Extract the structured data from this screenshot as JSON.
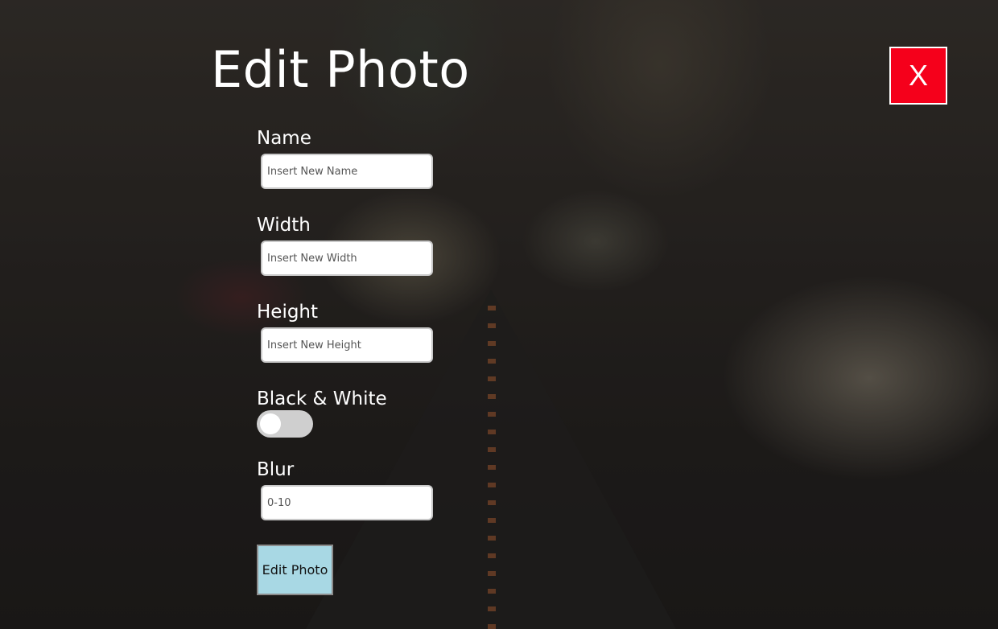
{
  "modal": {
    "title": "Edit Photo",
    "close_label": "X",
    "fields": {
      "name": {
        "label": "Name",
        "placeholder": "Insert New Name",
        "value": ""
      },
      "width": {
        "label": "Width",
        "placeholder": "Insert New Width",
        "value": ""
      },
      "height": {
        "label": "Height",
        "placeholder": "Insert New Height",
        "value": ""
      },
      "black_white": {
        "label": "Black & White",
        "checked": false
      },
      "blur": {
        "label": "Blur",
        "placeholder": "0-10",
        "value": ""
      }
    },
    "submit_label": "Edit Photo"
  },
  "colors": {
    "close_button": "#f5001b",
    "submit_button": "#a8d8e4",
    "toggle_track": "#cfcfcf"
  }
}
